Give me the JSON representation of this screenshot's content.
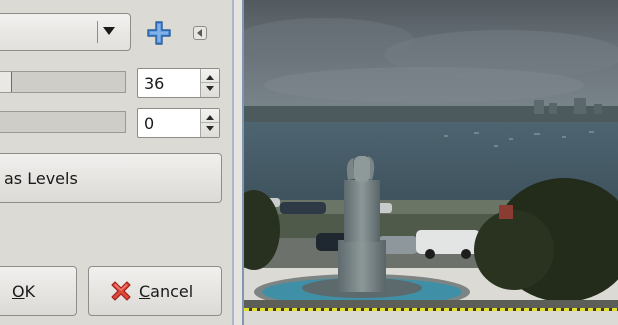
{
  "dialog": {
    "spin_top": {
      "value": "36"
    },
    "spin_bottom": {
      "value": "0"
    },
    "big_button_label": "as Levels",
    "ok": {
      "mnemonic": "O",
      "rest": "K"
    },
    "cancel": {
      "mnemonic": "C",
      "rest": "ancel"
    }
  },
  "icons": {
    "combo": "chevron-down-icon",
    "add": "plus-icon",
    "panel_nav": "triangle-left-icon",
    "cancel": "x-icon"
  },
  "colors": {
    "plus_icon": "#3f7fd0",
    "cancel_icon": "#d63b2f",
    "splitter": "#7f97b3",
    "dotted_border": "#e5e12a"
  },
  "sliders": [
    {
      "fraction": 0.09
    },
    {
      "fraction": 0.0
    }
  ]
}
